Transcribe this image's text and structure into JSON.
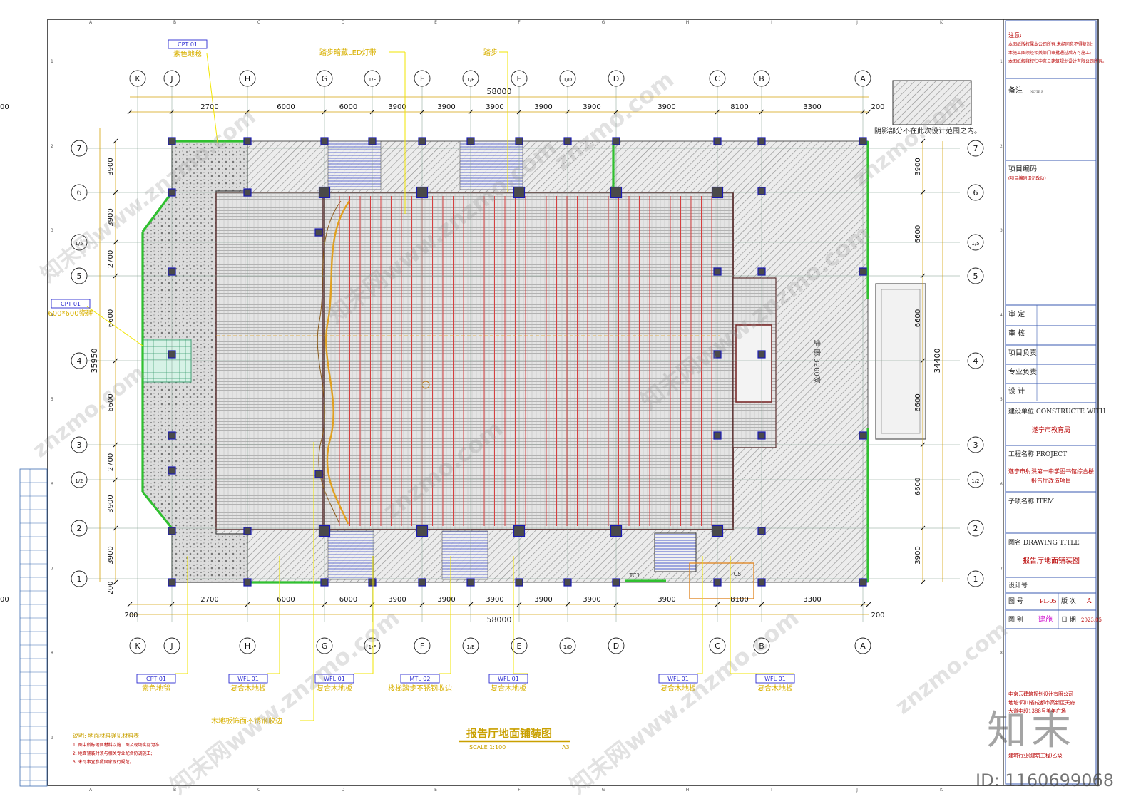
{
  "drawing": {
    "title": "报告厅地面铺装图",
    "scale": "SCALE 1:100",
    "sheet_ref": "A3",
    "legend_note": "阴影部分不在此次设计范围之内。",
    "overall_width_dim": "58000",
    "overall_depth_dim_left": "35950",
    "overall_depth_dim_right": "34400",
    "edge_dim": "200",
    "hall_label": "走 廊 3200宽",
    "door_labels": [
      "TC1",
      "C5"
    ]
  },
  "grid": {
    "columns": [
      "K",
      "J",
      "H",
      "G",
      "1/F",
      "F",
      "1/E",
      "E",
      "1/D",
      "D",
      "C",
      "B",
      "A"
    ],
    "rows": [
      "7",
      "6",
      "1/5",
      "5",
      "4",
      "3",
      "1/2",
      "2",
      "1"
    ],
    "col_spacings": [
      "2700",
      "6000",
      "6000",
      "3900",
      "3900",
      "3900",
      "3900",
      "3900",
      "3900",
      "8100",
      "3300",
      "8100"
    ],
    "row_spacings_left": [
      "3900",
      "3900",
      "2700",
      "6600",
      "6600",
      "2700",
      "3900",
      "3900"
    ],
    "row_spacings_right": [
      "3900",
      "6600",
      "6600",
      "6600",
      "6600",
      "3900"
    ],
    "sheet_letters": [
      "A",
      "B",
      "C",
      "D",
      "E",
      "F",
      "G",
      "H",
      "I",
      "J",
      "K"
    ],
    "sheet_numbers": [
      "1",
      "2",
      "3",
      "4",
      "5",
      "6",
      "7",
      "8",
      "9"
    ]
  },
  "callouts": {
    "top": [
      {
        "code": "CPT 01",
        "text": "素色地毯"
      },
      {
        "code": "",
        "text": "踏步暗藏LED灯带"
      },
      {
        "code": "",
        "text": "踏步"
      }
    ],
    "left": [
      {
        "code": "CPT 01",
        "text": "600*600瓷砖"
      }
    ],
    "bottom": [
      {
        "code": "CPT 01",
        "text": "素色地毯"
      },
      {
        "code": "WFL 01",
        "text": "复合木地板"
      },
      {
        "code": "WFL 01",
        "text": "复合木地板"
      },
      {
        "code": "MTL 02",
        "text": "楼梯踏步不锈钢收边"
      },
      {
        "code": "WFL 01",
        "text": "复合木地板"
      },
      {
        "code": "WFL 01",
        "text": "复合木地板"
      },
      {
        "code": "WFL 01",
        "text": "复合木地板"
      }
    ],
    "lower": "木地板饰面不锈钢收边"
  },
  "notes": [
    "说明: 地面材料详见材料表",
    "1. 图中所标地面材料以施工图及现场实际为准;",
    "2. 地面铺装时须与相关专业配合协调施工;",
    "3. 未尽事宜参照国家现行规范。"
  ],
  "titleblock": {
    "notice_head": "注意:",
    "notice_lines": [
      "本图纸版权属本公司所有,未经同意不得复制;",
      "本施工图须经相关部门审批通过后方可施工;",
      "本图纸解释权归中京云建筑规划设计有限公司所有。"
    ],
    "remarks_label": "备注",
    "remarks_en": "NOTES",
    "project_no_label": "项目编码",
    "project_no_sub": "(项目编码请勿改动)",
    "sign_rows": [
      "审 定",
      "审 核",
      "项目负责",
      "专业负责",
      "设 计"
    ],
    "construct_label": "建设单位 CONSTRUCTE WITH",
    "construct_value": "遂宁市教育局",
    "project_label": "工程名称 PROJECT",
    "project_value_1": "遂宁市射洪第一中学图书馆综合楼",
    "project_value_2": "报告厅改造项目",
    "item_label": "子项名称 ITEM",
    "drawing_title_label": "图名  DRAWING TITLE",
    "drawing_title_value": "报告厅地面铺装图",
    "design_no_label": "设计号",
    "drawing_no_label": "图 号",
    "drawing_no_value": "PL-05",
    "version_label": "版 次",
    "version_value": "A",
    "category_label": "图 别",
    "category_value": "建施",
    "date_label": "日 期",
    "date_value": "2023.05",
    "company_lines": [
      "中京云建筑规划设计有限公司",
      "地址:四川省成都市高新区天府",
      "大道中段1388号美年广场"
    ],
    "cert_line": "建筑行业(建筑工程)乙级"
  },
  "watermark": {
    "site": "znzmo.com",
    "brand": "知末网www.znzmo.com",
    "logo": "知末",
    "id": "ID: 1160699068"
  },
  "colors": {
    "border": "#2e2e2e",
    "grid_line": "#7f9a8c",
    "dimension": "#d4a20a",
    "callout": "#f2e600",
    "callout_box": "#2a2ad0",
    "column": "#4a4a4a",
    "column_edge": "#1a1ab4",
    "hatch": "#9a9a9a",
    "strip": "#d64040",
    "floor": "#e2e2e2",
    "curtain": "#e0a020",
    "glass": "#30c030",
    "seal": "#cc00cc"
  }
}
